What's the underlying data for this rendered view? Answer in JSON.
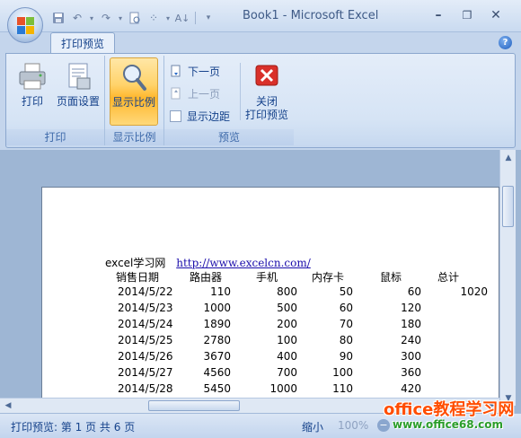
{
  "window": {
    "title": "Book1 - Microsoft Excel",
    "minimize": "–",
    "restore": "❐",
    "close": "✕"
  },
  "ribbon": {
    "tab": "打印预览",
    "help": "?",
    "groups": {
      "print": {
        "label": "打印",
        "print_button": "打印",
        "page_setup_button": "页面设置"
      },
      "zoom": {
        "label": "显示比例",
        "zoom_button": "显示比例"
      },
      "preview": {
        "label": "预览",
        "next_page": "下一页",
        "prev_page": "上一页",
        "show_margins": "显示边距",
        "close_line1": "关闭",
        "close_line2": "打印预览"
      }
    }
  },
  "page": {
    "header_text": "excel学习网",
    "header_link": "http://www.excelcn.com/",
    "columns": [
      "销售日期",
      "路由器",
      "手机",
      "内存卡",
      "鼠标",
      "总计"
    ],
    "rows": [
      [
        "2014/5/22",
        "110",
        "800",
        "50",
        "60",
        "1020"
      ],
      [
        "2014/5/23",
        "1000",
        "500",
        "60",
        "120",
        ""
      ],
      [
        "2014/5/24",
        "1890",
        "200",
        "70",
        "180",
        ""
      ],
      [
        "2014/5/25",
        "2780",
        "100",
        "80",
        "240",
        ""
      ],
      [
        "2014/5/26",
        "3670",
        "400",
        "90",
        "300",
        ""
      ],
      [
        "2014/5/27",
        "4560",
        "700",
        "100",
        "360",
        ""
      ],
      [
        "2014/5/28",
        "5450",
        "1000",
        "110",
        "420",
        ""
      ]
    ]
  },
  "status": {
    "page_info": "打印预览: 第 1 页 共 6 页",
    "zoom_label": "缩小",
    "zoom_value": "100%",
    "zoom_out": "−"
  },
  "watermark": {
    "line1": "office教程学习网",
    "line2": "www.office68.com"
  },
  "colors": {
    "accent": "#15428b",
    "ribbon_bg": "#d6e4f5",
    "active_button": "#ffd36b",
    "close_icon": "#d9302a"
  }
}
